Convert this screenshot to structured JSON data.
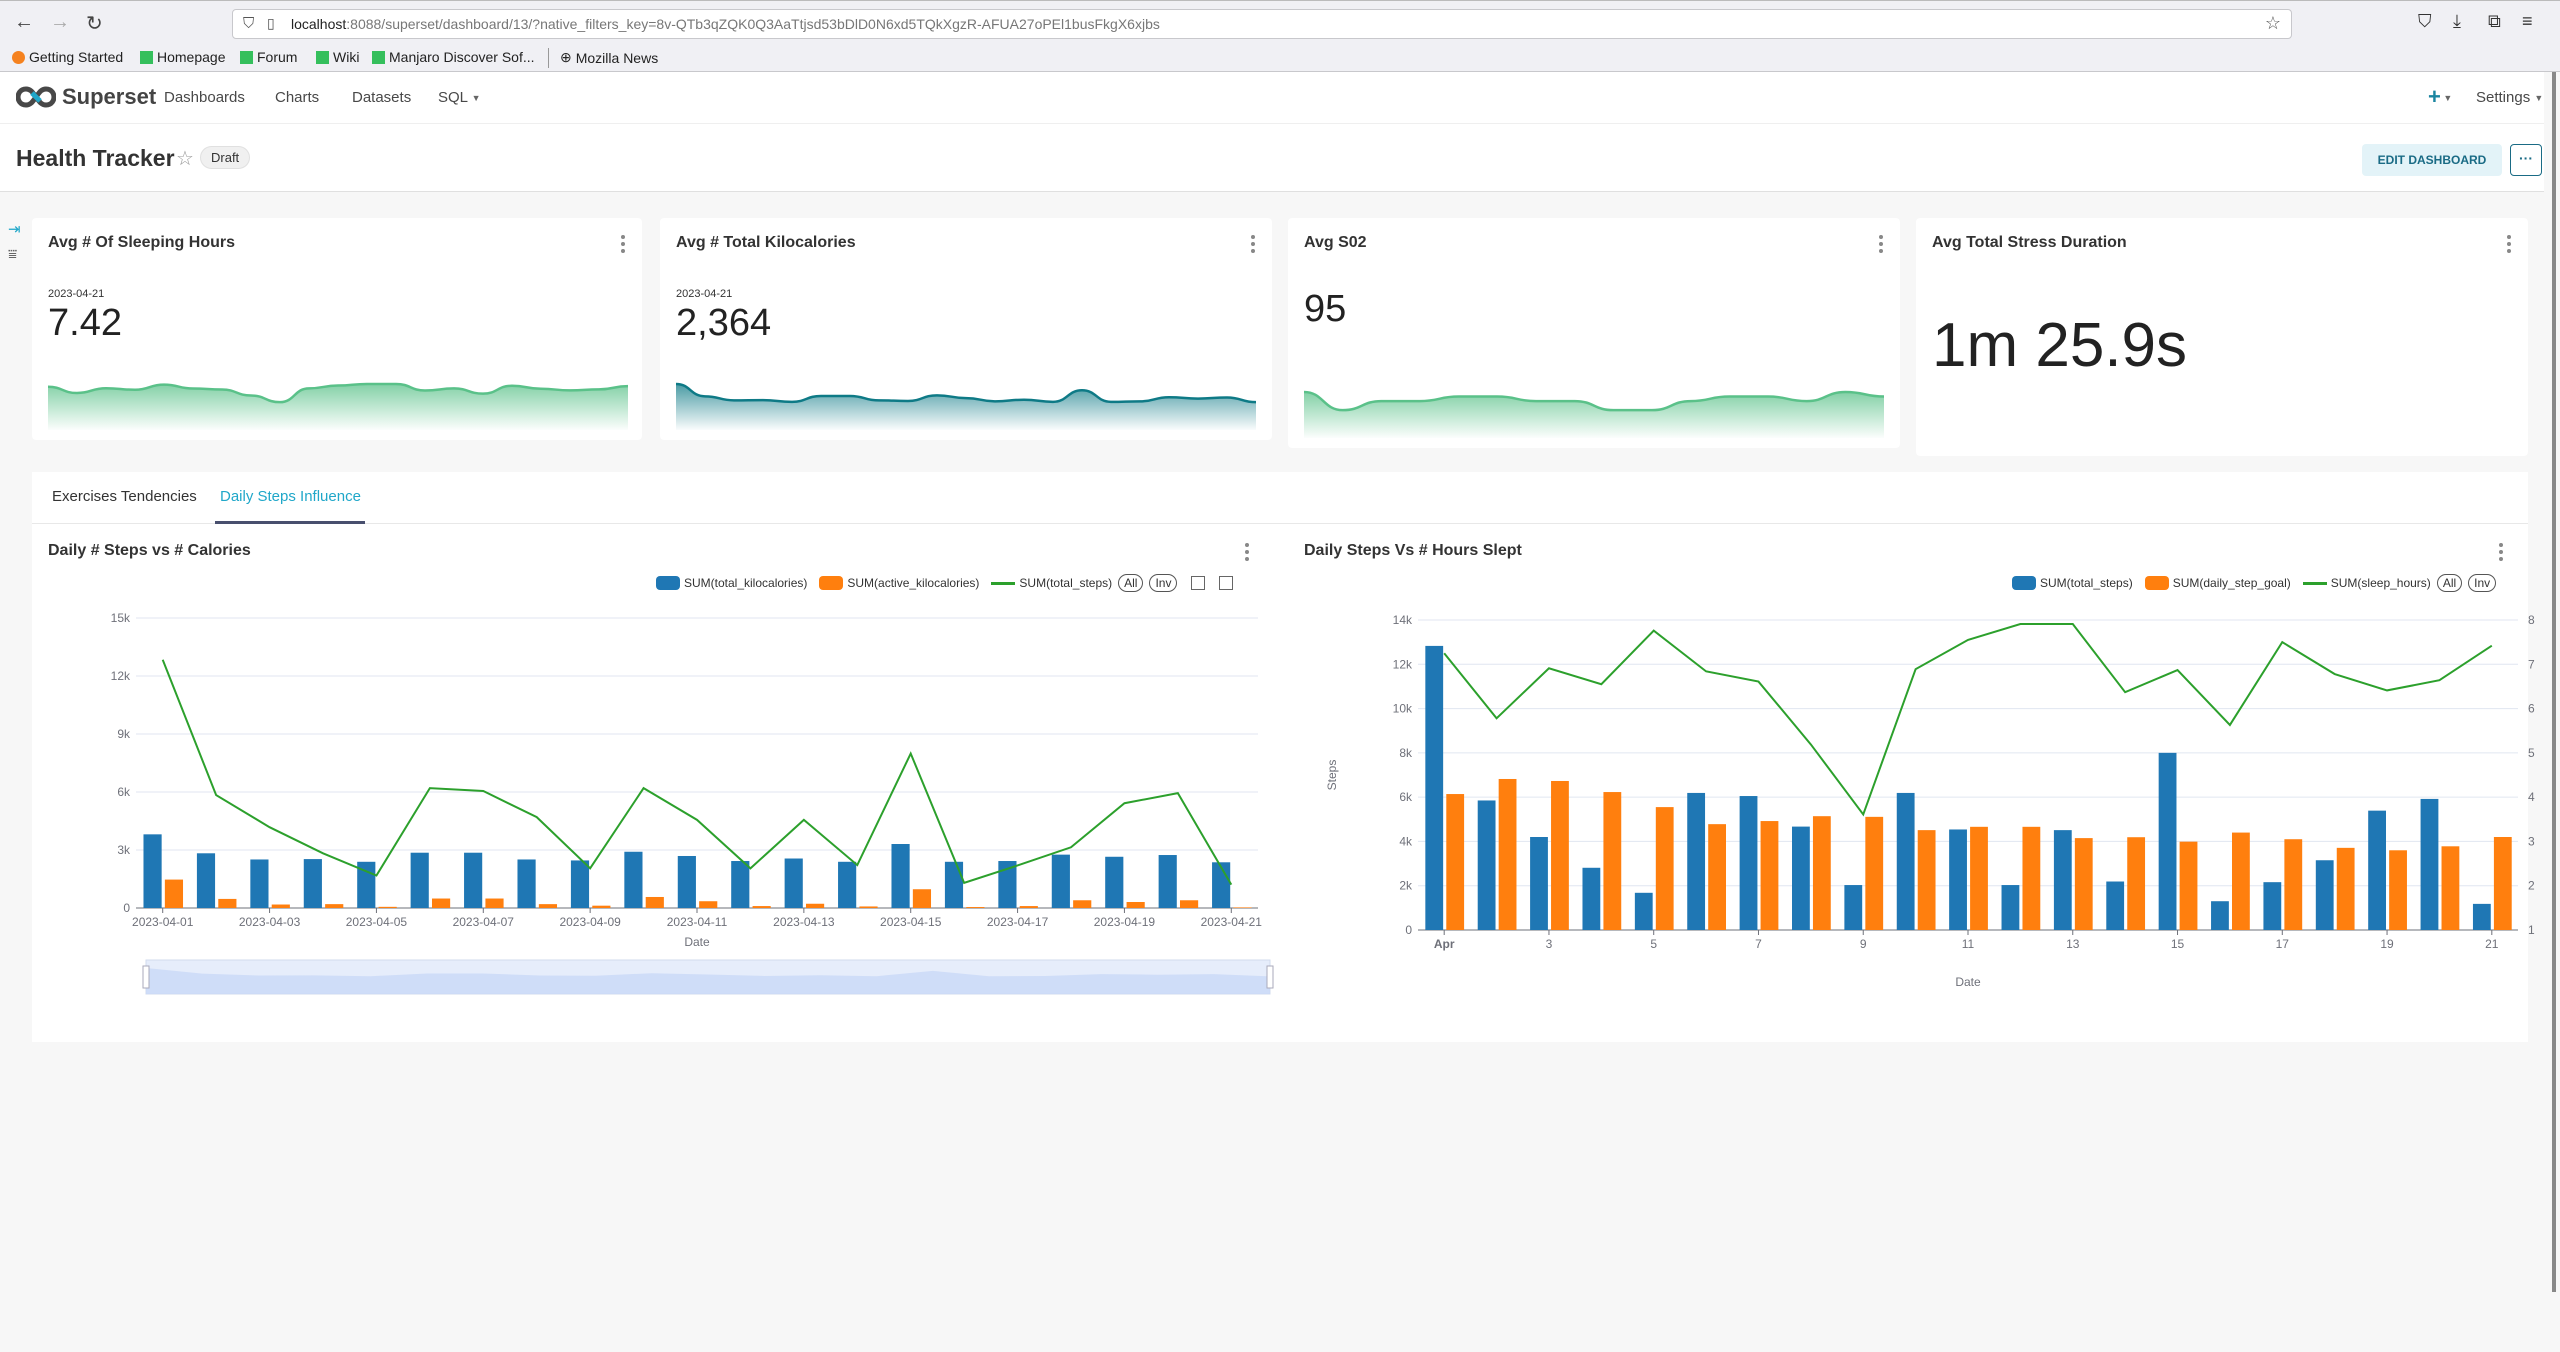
{
  "browser": {
    "url_host": "localhost",
    "url_rest": ":8088/superset/dashboard/13/?native_filters_key=8v-QTb3qZQK0Q3AaTtjsd53bDlD0N6xd5TQkXgzR-AFUA27oPEl1busFkgX6xjbs",
    "bookmarks": [
      "Getting Started",
      "Homepage",
      "Forum",
      "Wiki",
      "Manjaro Discover Sof...",
      "Mozilla News"
    ]
  },
  "nav": {
    "brand": "Superset",
    "menu": [
      "Dashboards",
      "Charts",
      "Datasets",
      "SQL"
    ],
    "settings": "Settings"
  },
  "header": {
    "title": "Health Tracker",
    "status": "Draft",
    "edit_label": "EDIT DASHBOARD",
    "more_label": "···"
  },
  "kpis": [
    {
      "title": "Avg # Of Sleeping Hours",
      "date": "2023-04-21",
      "value": "7.42",
      "color": "#5ac189",
      "trend": [
        7.25,
        5.78,
        6.91,
        6.55,
        7.76,
        6.84,
        6.61,
        5.19,
        3.61,
        6.89,
        7.55,
        7.91,
        7.91,
        6.37,
        6.87,
        5.63,
        7.5,
        6.78,
        6.41,
        6.64,
        7.42
      ]
    },
    {
      "title": "Avg # Total Kilocalories",
      "date": "2023-04-21",
      "value": "2,364",
      "color": "#0e7a86",
      "trend": [
        3810,
        2830,
        2510,
        2530,
        2390,
        2860,
        2860,
        2510,
        2460,
        2910,
        2690,
        2430,
        2560,
        2390,
        3310,
        2390,
        2430,
        2760,
        2650,
        2740,
        2364
      ]
    },
    {
      "title": "Avg S02",
      "date": "",
      "value": "95",
      "color": "#5ac189",
      "trend": [
        95.2,
        94.8,
        95,
        95,
        95.1,
        95.1,
        95,
        95,
        94.8,
        94.8,
        95,
        95.1,
        95.1,
        95,
        95.2,
        95.1
      ]
    },
    {
      "title": "Avg Total Stress Duration",
      "date": "",
      "value": "1m 25.9s",
      "color": "",
      "trend": []
    }
  ],
  "tabs": [
    {
      "label": "Exercises Tendencies",
      "active": false
    },
    {
      "label": "Daily Steps Influence",
      "active": true
    }
  ],
  "chart_data": [
    {
      "type": "bar",
      "title": "Daily # Steps vs # Calories",
      "xlabel": "Date",
      "ylabel": "",
      "ylim": [
        0,
        15000
      ],
      "yticks": [
        "0",
        "3k",
        "6k",
        "9k",
        "12k",
        "15k"
      ],
      "categories": [
        "2023-04-01",
        "2023-04-02",
        "2023-04-03",
        "2023-04-04",
        "2023-04-05",
        "2023-04-06",
        "2023-04-07",
        "2023-04-08",
        "2023-04-09",
        "2023-04-10",
        "2023-04-11",
        "2023-04-12",
        "2023-04-13",
        "2023-04-14",
        "2023-04-15",
        "2023-04-16",
        "2023-04-17",
        "2023-04-18",
        "2023-04-19",
        "2023-04-20",
        "2023-04-21"
      ],
      "xtick_labels": [
        "2023-04-01",
        "2023-04-03",
        "2023-04-05",
        "2023-04-07",
        "2023-04-09",
        "2023-04-11",
        "2023-04-13",
        "2023-04-15",
        "2023-04-17",
        "2023-04-19",
        "2023-04-21"
      ],
      "series": [
        {
          "name": "SUM(total_kilocalories)",
          "kind": "bar",
          "color": "#1f77b4",
          "values": [
            3810,
            2830,
            2510,
            2530,
            2390,
            2860,
            2860,
            2510,
            2460,
            2910,
            2690,
            2430,
            2560,
            2390,
            3310,
            2390,
            2430,
            2760,
            2650,
            2740,
            2364
          ]
        },
        {
          "name": "SUM(active_kilocalories)",
          "kind": "bar",
          "color": "#ff7f0e",
          "values": [
            1470,
            470,
            180,
            200,
            60,
            490,
            490,
            200,
            120,
            570,
            350,
            100,
            220,
            80,
            970,
            50,
            100,
            400,
            310,
            400,
            30
          ]
        },
        {
          "name": "SUM(total_steps)",
          "kind": "line",
          "color": "#2ca02c",
          "values": [
            12840,
            5840,
            4180,
            2830,
            1680,
            6200,
            6050,
            4700,
            2050,
            6200,
            4560,
            2050,
            4560,
            2220,
            7990,
            1300,
            2200,
            3140,
            5420,
            5940,
            1210
          ]
        }
      ],
      "legend": "top-right",
      "legend_controls": [
        "All",
        "Inv"
      ],
      "grid": true,
      "zoom_slider": true
    },
    {
      "type": "bar",
      "title": "Daily Steps Vs # Hours Slept",
      "xlabel": "Date",
      "ylabel": "Steps",
      "ylim": [
        0,
        14000
      ],
      "yticks": [
        "0",
        "2k",
        "4k",
        "6k",
        "8k",
        "10k",
        "12k",
        "14k"
      ],
      "y2lim": [
        1,
        8
      ],
      "y2ticks": [
        "1",
        "2",
        "3",
        "4",
        "5",
        "6",
        "7",
        "8"
      ],
      "categories": [
        "Apr",
        "2",
        "3",
        "4",
        "5",
        "6",
        "7",
        "8",
        "9",
        "10",
        "11",
        "12",
        "13",
        "14",
        "15",
        "16",
        "17",
        "18",
        "19",
        "20",
        "21"
      ],
      "xtick_labels": [
        "Apr",
        "3",
        "5",
        "7",
        "9",
        "11",
        "13",
        "15",
        "17",
        "19",
        "21"
      ],
      "series": [
        {
          "name": "SUM(total_steps)",
          "kind": "bar",
          "color": "#1f77b4",
          "values": [
            12830,
            5850,
            4200,
            2810,
            1680,
            6190,
            6050,
            4670,
            2030,
            6190,
            4540,
            2030,
            4510,
            2190,
            8000,
            1300,
            2160,
            3150,
            5390,
            5920,
            1180
          ]
        },
        {
          "name": "SUM(daily_step_goal)",
          "kind": "bar",
          "color": "#ff7f0e",
          "values": [
            6140,
            6820,
            6730,
            6230,
            5550,
            4780,
            4920,
            5140,
            5110,
            4510,
            4660,
            4660,
            4150,
            4190,
            3990,
            4400,
            4100,
            3710,
            3600,
            3780,
            4200
          ]
        },
        {
          "name": "SUM(sleep_hours)",
          "kind": "line",
          "axis": "right",
          "color": "#2ca02c",
          "values": [
            7.25,
            5.78,
            6.91,
            6.55,
            7.76,
            6.84,
            6.61,
            5.19,
            3.61,
            6.89,
            7.55,
            7.91,
            7.91,
            6.37,
            6.87,
            5.63,
            7.5,
            6.78,
            6.41,
            6.64,
            7.42
          ]
        }
      ],
      "legend": "top-right",
      "legend_controls": [
        "All",
        "Inv"
      ],
      "grid": true
    }
  ]
}
